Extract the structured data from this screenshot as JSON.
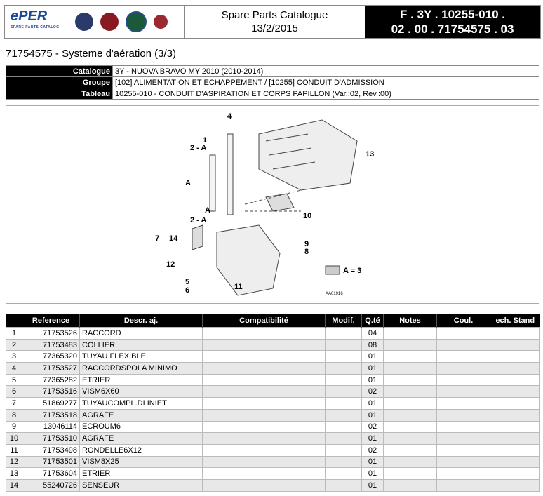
{
  "header": {
    "logo_text": "ePER",
    "logo_sub": "SPARE PARTS CATALOG",
    "title": "Spare Parts Catalogue",
    "date": "13/2/2015",
    "code_line1": "F . 3Y . 10255-010 .",
    "code_line2": "02 . 00 . 71754575 . 03"
  },
  "page_title": "71754575 - Systeme d'aération (3/3)",
  "info": [
    {
      "label": "Catalogue",
      "value": "3Y - NUOVA BRAVO MY 2010 (2010-2014)"
    },
    {
      "label": "Groupe",
      "value": "[102] ALIMENTATION ET ECHAPPEMENT / [10255] CONDUIT D'ADMISSION"
    },
    {
      "label": "Tableau",
      "value": "10255-010 - CONDUIT D'ASPIRATION ET CORPS PAPILLON (Var.:02, Rev.:00)"
    }
  ],
  "diagram": {
    "labels": [
      "1",
      "2 - A",
      "A",
      "A",
      "2 - A",
      "4",
      "13",
      "10",
      "7",
      "14",
      "9",
      "8",
      "12",
      "5",
      "6",
      "11"
    ],
    "legend": "A = 3",
    "ref": "AA01916"
  },
  "table": {
    "headers": [
      "",
      "Reference",
      "Descr. aj.",
      "Compatibilité",
      "Modif.",
      "Q.té",
      "Notes",
      "Coul.",
      "ech. Stand"
    ],
    "rows": [
      [
        "1",
        "71753526",
        "RACCORD",
        "04"
      ],
      [
        "2",
        "71753483",
        "COLLIER",
        "08"
      ],
      [
        "3",
        "77365320",
        "TUYAU FLEXIBLE",
        "01"
      ],
      [
        "4",
        "71753527",
        "RACCORDSPOLA MINIMO",
        "01"
      ],
      [
        "5",
        "77365282",
        "ETRIER",
        "01"
      ],
      [
        "6",
        "71753516",
        "VISM6X60",
        "02"
      ],
      [
        "7",
        "51869277",
        "TUYAUCOMPL.DI INIET",
        "01"
      ],
      [
        "8",
        "71753518",
        "AGRAFE",
        "01"
      ],
      [
        "9",
        "13046114",
        "ECROUM6",
        "02"
      ],
      [
        "10",
        "71753510",
        "AGRAFE",
        "01"
      ],
      [
        "11",
        "71753498",
        "RONDELLE6X12",
        "02"
      ],
      [
        "12",
        "71753501",
        "VISM8X25",
        "01"
      ],
      [
        "13",
        "71753604",
        "ETRIER",
        "01"
      ],
      [
        "14",
        "55240726",
        "SENSEUR",
        "01"
      ]
    ]
  }
}
